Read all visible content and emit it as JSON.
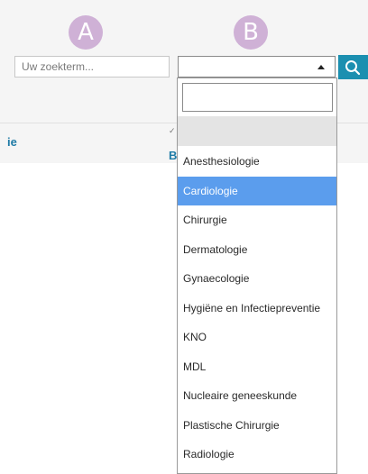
{
  "markers": {
    "a": "A",
    "b": "B"
  },
  "search": {
    "placeholder": "Uw zoekterm..."
  },
  "select": {
    "selected_value": ""
  },
  "columns": {
    "partial_label": "ie",
    "b_label": "B"
  },
  "dropdown": {
    "filter_value": "",
    "options": [
      "Anesthesiologie",
      "Cardiologie",
      "Chirurgie",
      "Dermatologie",
      "Gynaecologie",
      "Hygiëne en Infectiepreventie",
      "KNO",
      "MDL",
      "Nucleaire geneeskunde",
      "Plastische Chirurgie",
      "Radiologie"
    ],
    "highlighted": "Cardiologie"
  },
  "colors": {
    "accent": "#1b8fb0",
    "marker": "#cfb1d6",
    "highlight": "#5b9ded",
    "link": "#1f7ba6"
  }
}
